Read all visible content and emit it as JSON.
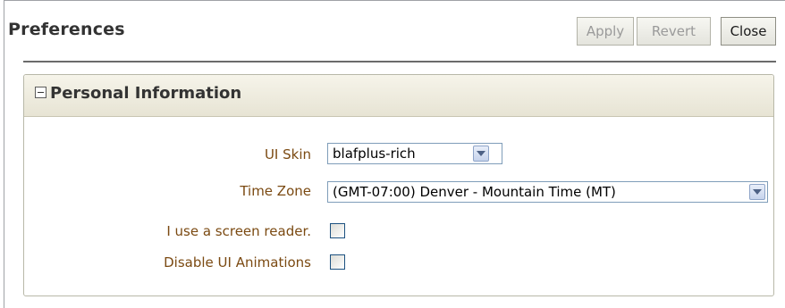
{
  "header": {
    "title": "Preferences",
    "buttons": {
      "apply": "Apply",
      "revert": "Revert",
      "close": "Close"
    }
  },
  "section": {
    "title": "Personal Information",
    "fields": {
      "ui_skin": {
        "label": "UI Skin",
        "value": "blafplus-rich"
      },
      "time_zone": {
        "label": "Time Zone",
        "value": "(GMT-07:00) Denver - Mountain Time (MT)"
      },
      "screen_reader": {
        "label": "I use a screen reader.",
        "checked": false
      },
      "disable_animations": {
        "label": "Disable UI Animations",
        "checked": false
      }
    }
  },
  "colors": {
    "label_text": "#7b4a12",
    "header_gradient_top": "#f6f4ea",
    "header_gradient_bottom": "#e7e4d4",
    "disabled_button_text": "#9a9a9a"
  },
  "icons": {
    "section_toggle": "collapse-minus-icon",
    "dropdown": "chevron-down-icon"
  }
}
